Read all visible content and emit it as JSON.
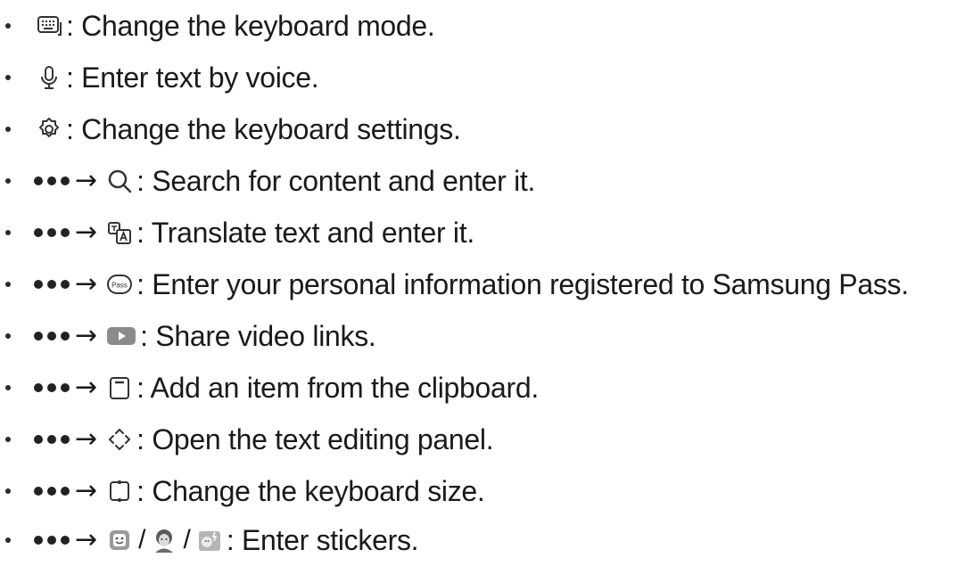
{
  "items": [
    {
      "text": ": Change the keyboard mode.",
      "icon": "keyboard-mode-icon"
    },
    {
      "text": ": Enter text by voice.",
      "icon": "microphone-icon"
    },
    {
      "text": ": Change the keyboard settings.",
      "icon": "gear-icon"
    },
    {
      "text": ": Search for content and enter it.",
      "icon": "search-icon"
    },
    {
      "text": ": Translate text and enter it.",
      "icon": "translate-icon"
    },
    {
      "text": ": Enter your personal information registered to Samsung Pass.",
      "icon": "samsung-pass-icon",
      "icon_label": "Pass"
    },
    {
      "text": ": Share video links.",
      "icon": "video-play-icon"
    },
    {
      "text": ": Add an item from the clipboard.",
      "icon": "clipboard-icon"
    },
    {
      "text": ": Open the text editing panel.",
      "icon": "text-editing-icon"
    },
    {
      "text": ": Change the keyboard size.",
      "icon": "keyboard-size-icon"
    },
    {
      "text": ": Enter stickers.",
      "icons": [
        "sticker-icon",
        "ar-emoji-icon",
        "bitmoji-icon"
      ],
      "separator": "/"
    }
  ],
  "arrow": "→"
}
